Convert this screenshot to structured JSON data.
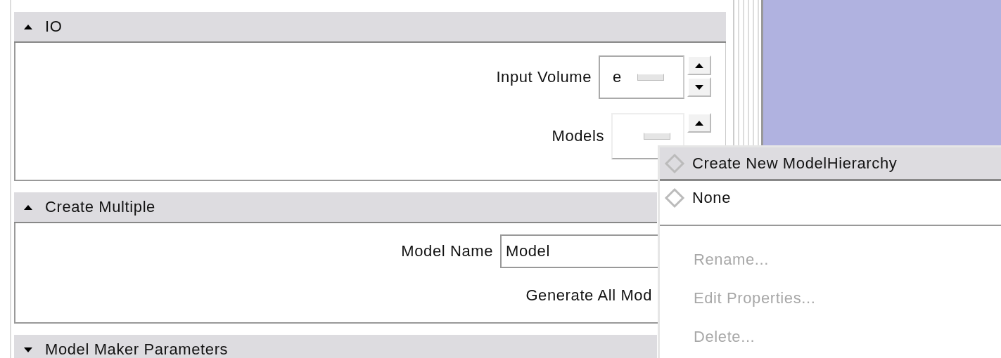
{
  "sections": [
    {
      "title": "IO",
      "expanded": true,
      "fields": [
        {
          "kind": "spinner",
          "label": "Input Volume",
          "value": "e"
        },
        {
          "kind": "picker",
          "label": "Models"
        }
      ]
    },
    {
      "title": "Create Multiple",
      "expanded": true,
      "fields": [
        {
          "kind": "text",
          "label": "Model Name",
          "value": "Model"
        },
        {
          "kind": "button",
          "label": "Generate All Mod"
        }
      ]
    },
    {
      "title": "Model Maker Parameters",
      "expanded": false
    }
  ],
  "popup_menu": {
    "groups": [
      [
        {
          "label": "Create New ModelHierarchy",
          "kind": "radio",
          "highlighted": true,
          "disabled": false
        },
        {
          "label": "None",
          "kind": "radio",
          "highlighted": false,
          "disabled": false
        }
      ],
      [
        {
          "label": "Rename...",
          "kind": "action",
          "highlighted": false,
          "disabled": true
        },
        {
          "label": "Edit Properties...",
          "kind": "action",
          "highlighted": false,
          "disabled": true
        },
        {
          "label": "Delete...",
          "kind": "action",
          "highlighted": false,
          "disabled": true
        }
      ]
    ]
  }
}
